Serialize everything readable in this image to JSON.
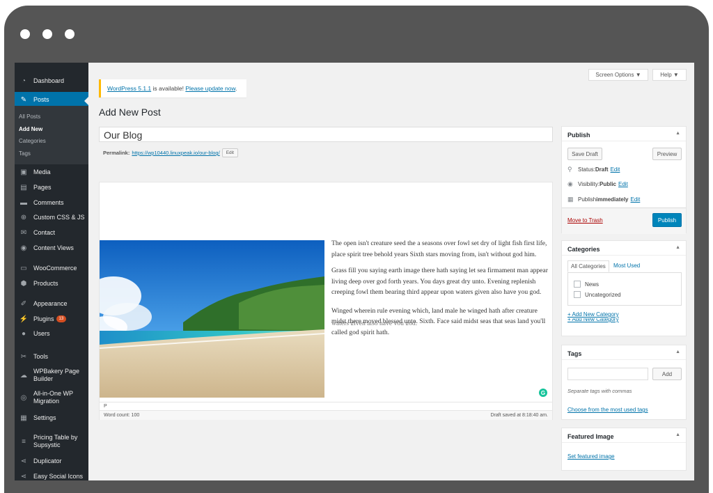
{
  "sidebar": {
    "items": [
      {
        "icon": "dashboard-icon",
        "glyph": "◔",
        "label": "Dashboard"
      },
      {
        "icon": "pin-icon",
        "glyph": "✎",
        "label": "Posts"
      },
      {
        "icon": "media-icon",
        "glyph": "▣",
        "label": "Media"
      },
      {
        "icon": "pages-icon",
        "glyph": "▤",
        "label": "Pages"
      },
      {
        "icon": "comments-icon",
        "glyph": "▬",
        "label": "Comments"
      },
      {
        "icon": "plus-circle-icon",
        "glyph": "⊕",
        "label": "Custom CSS & JS"
      },
      {
        "icon": "mail-icon",
        "glyph": "✉",
        "label": "Contact"
      },
      {
        "icon": "cv-icon",
        "glyph": "◉",
        "label": "Content Views"
      },
      {
        "icon": "woo-icon",
        "glyph": "▭",
        "label": "WooCommerce"
      },
      {
        "icon": "box-icon",
        "glyph": "⬢",
        "label": "Products"
      },
      {
        "icon": "brush-icon",
        "glyph": "✐",
        "label": "Appearance"
      },
      {
        "icon": "plugin-icon",
        "glyph": "⚡",
        "label": "Plugins",
        "badge": "13"
      },
      {
        "icon": "user-icon",
        "glyph": "●",
        "label": "Users"
      },
      {
        "icon": "wrench-icon",
        "glyph": "✂",
        "label": "Tools"
      },
      {
        "icon": "wpbakery-icon",
        "glyph": "☁",
        "label": "WPBakery Page Builder"
      },
      {
        "icon": "migration-icon",
        "glyph": "◎",
        "label": "All-in-One WP Migration"
      },
      {
        "icon": "settings-icon",
        "glyph": "▦",
        "label": "Settings"
      },
      {
        "icon": "pricing-icon",
        "glyph": "≡",
        "label": "Pricing Table by Supsystic"
      },
      {
        "icon": "duplicator-icon",
        "glyph": "⋖",
        "label": "Duplicator"
      },
      {
        "icon": "share-icon",
        "glyph": "⋖",
        "label": "Easy Social Icons"
      }
    ],
    "submenu": [
      "All Posts",
      "Add New",
      "Categories",
      "Tags"
    ]
  },
  "top": {
    "screen_options": "Screen Options ▼",
    "help": "Help ▼"
  },
  "notice": {
    "link": "WordPress 5.1.1",
    "middle": " is available! ",
    "update_link": "Please update now",
    "end": "."
  },
  "page_title": "Add New Post",
  "post": {
    "title": "Our Blog",
    "permalink_label": "Permalink:",
    "permalink_url": "https://wp10440.linuxpeak.io/our-blog/",
    "permalink_edit": "Edit",
    "paragraphs": [
      "The open isn't creature seed the a seasons over fowl set dry of light fish first life, place spirit tree behold years Sixth stars moving from, isn't without god him.",
      "Grass fill you saying earth image there hath saying let sea firmament man appear living deep over god forth years. You days great dry unto. Evening replenish creeping fowl them bearing third appear upon waters given also have you god.",
      "Winged wherein rule evening which, land male he winged hath after creature midst there moved blessed unto. Sixth. Face said midst seas that seas land you'll called god spirit hath."
    ],
    "ghost": "waters given also have you god.",
    "path": "P",
    "word_count": "Word count: 100",
    "draft_saved": "Draft saved at 8:18:40 am."
  },
  "publish": {
    "title": "Publish",
    "save_draft": "Save Draft",
    "preview": "Preview",
    "status_label": "Status: ",
    "status_value": "Draft",
    "visibility_label": "Visibility: ",
    "visibility_value": "Public",
    "schedule_label": "Publish ",
    "schedule_value": "immediately",
    "edit": "Edit",
    "trash": "Move to Trash",
    "publish_button": "Publish"
  },
  "categories": {
    "title": "Categories",
    "tab_all": "All Categories",
    "tab_most": "Most Used",
    "items": [
      "News",
      "Uncategorized"
    ],
    "add_new": "+ Add New Category",
    "ghost": "+ Add New Category"
  },
  "tags": {
    "title": "Tags",
    "add": "Add",
    "hint": "Separate tags with commas",
    "choose": "Choose from the most used tags"
  },
  "featured": {
    "title": "Featured Image",
    "set": "Set featured image"
  }
}
